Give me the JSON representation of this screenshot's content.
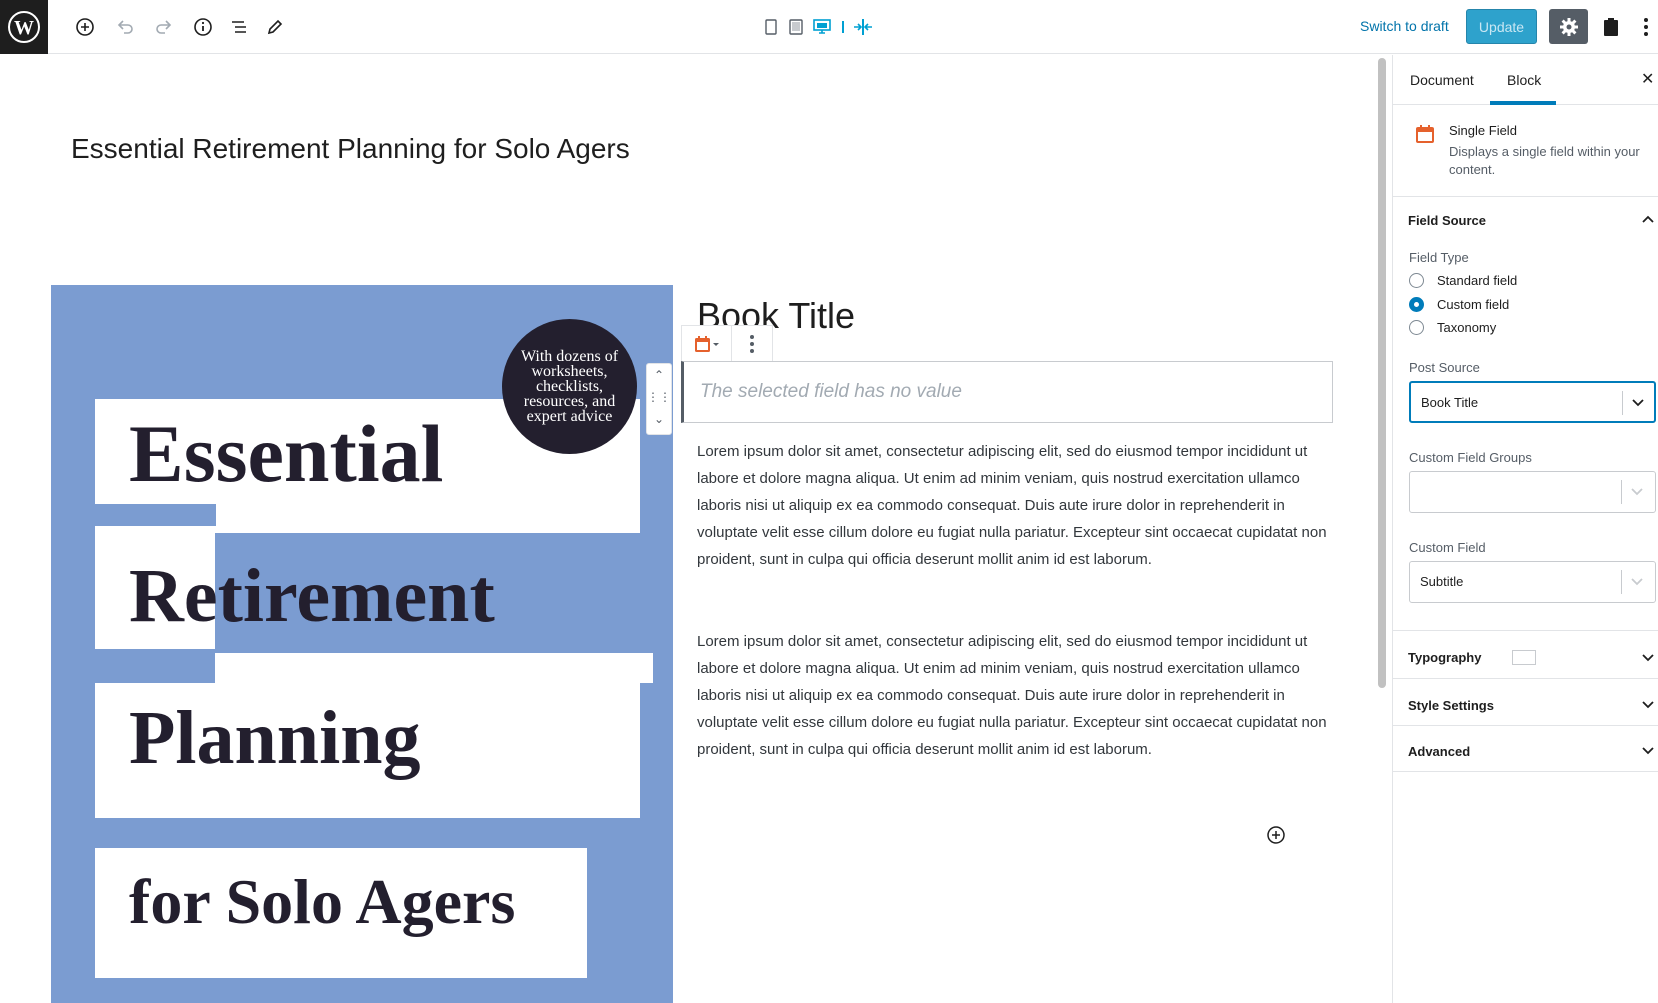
{
  "toolbar": {
    "logo_icon": "wordpress-logo-icon",
    "icons": [
      "add-block-icon",
      "undo-icon",
      "redo-icon",
      "info-icon",
      "list-view-icon",
      "edit-icon"
    ],
    "preview_icons": [
      "mobile-preview-icon",
      "tablet-preview-icon",
      "desktop-preview-icon",
      "divider-icon",
      "fullwidth-icon"
    ],
    "switch_to_draft": "Switch to draft",
    "update": "Update",
    "accent_color": "#0073aa"
  },
  "editor": {
    "post_title": "Essential Retirement Planning for Solo Agers",
    "cover": {
      "badge": "With dozens of worksheets, checklists, resources, and expert advice",
      "words": [
        "Essential",
        "Retirement",
        "Planning",
        "for Solo Agers"
      ],
      "background_color": "#7b9cd1"
    },
    "book_title": "Book Title",
    "field_placeholder": "The selected field has no value",
    "paragraphs": [
      "Lorem ipsum dolor sit amet, consectetur adipiscing elit, sed do eiusmod tempor incididunt ut labore et dolore magna aliqua. Ut enim ad minim veniam, quis nostrud exercitation ullamco laboris nisi ut aliquip ex ea commodo consequat. Duis aute irure dolor in reprehenderit in voluptate velit esse cillum dolore eu fugiat nulla pariatur. Excepteur sint occaecat cupidatat non proident, sunt in culpa qui officia deserunt mollit anim id est laborum.",
      "Lorem ipsum dolor sit amet, consectetur adipiscing elit, sed do eiusmod tempor incididunt ut labore et dolore magna aliqua. Ut enim ad minim veniam, quis nostrud exercitation ullamco laboris nisi ut aliquip ex ea commodo consequat. Duis aute irure dolor in reprehenderit in voluptate velit esse cillum dolore eu fugiat nulla pariatur. Excepteur sint occaecat cupidatat non proident, sunt in culpa qui officia deserunt mollit anim id est laborum."
    ]
  },
  "sidebar": {
    "tabs": [
      {
        "label": "Document",
        "active": false
      },
      {
        "label": "Block",
        "active": true
      }
    ],
    "block": {
      "name": "Single Field",
      "description": "Displays a single field within your content.",
      "icon": "calendar-icon",
      "icon_color": "#e5612d"
    },
    "field_source": {
      "heading": "Field Source",
      "field_type_label": "Field Type",
      "options": [
        {
          "label": "Standard field",
          "selected": false
        },
        {
          "label": "Custom field",
          "selected": true
        },
        {
          "label": "Taxonomy",
          "selected": false
        }
      ],
      "post_source_label": "Post Source",
      "post_source_value": "Book Title",
      "custom_field_groups_label": "Custom Field Groups",
      "custom_field_groups_value": "",
      "custom_field_label": "Custom Field",
      "custom_field_value": "Subtitle"
    },
    "sections": [
      {
        "label": "Typography"
      },
      {
        "label": "Style Settings"
      },
      {
        "label": "Advanced"
      }
    ]
  }
}
